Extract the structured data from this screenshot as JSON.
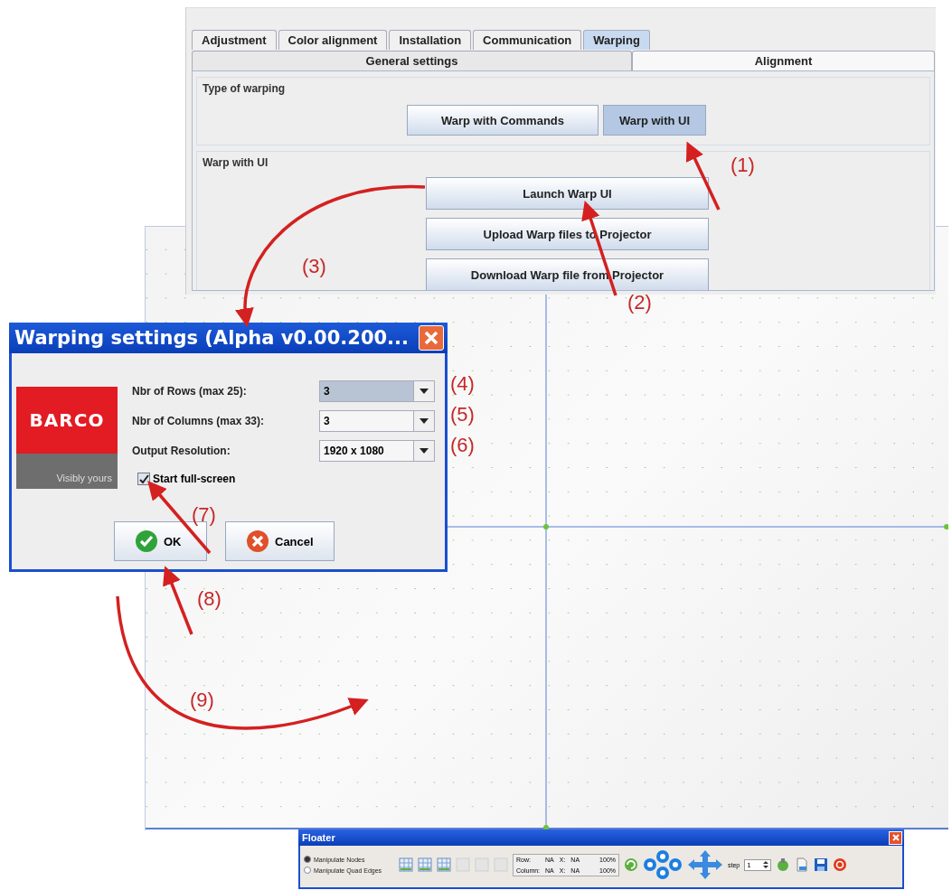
{
  "config_window": {
    "tabs": [
      {
        "label": "Adjustment",
        "selected": false
      },
      {
        "label": "Color alignment",
        "selected": false
      },
      {
        "label": "Installation",
        "selected": false
      },
      {
        "label": "Communication",
        "selected": false
      },
      {
        "label": "Warping",
        "selected": true
      }
    ],
    "subtabs": [
      {
        "label": "General settings",
        "selected": false
      },
      {
        "label": "Alignment",
        "selected": true
      }
    ],
    "type_of_warping": {
      "title": "Type of warping",
      "buttons": [
        {
          "label": "Warp with Commands",
          "selected": false
        },
        {
          "label": "Warp with UI",
          "selected": true
        }
      ]
    },
    "warp_with_ui": {
      "title": "Warp with UI",
      "buttons": [
        "Launch Warp UI",
        "Upload Warp files to Projector",
        "Download Warp file from Projector"
      ]
    }
  },
  "dialog": {
    "title": "Warping settings (Alpha v0.00.200...",
    "logo": {
      "brand": "BARCO",
      "tagline": "Visibly yours"
    },
    "fields": [
      {
        "label": "Nbr of Rows (max 25):",
        "value": "3",
        "focused": true
      },
      {
        "label": "Nbr of Columns (max 33):",
        "value": "3",
        "focused": false
      },
      {
        "label": "Output Resolution:",
        "value": "1920 x 1080",
        "focused": false
      }
    ],
    "checkbox": {
      "label": "Start full-screen",
      "checked": true
    },
    "buttons": [
      {
        "label": "OK",
        "kind": "ok"
      },
      {
        "label": "Cancel",
        "kind": "cancel"
      }
    ]
  },
  "floater": {
    "title": "Floater",
    "modes": [
      {
        "label": "Manipulate Nodes",
        "selected": true
      },
      {
        "label": "Manipulate Quad Edges",
        "selected": false
      }
    ],
    "readouts": [
      {
        "label": "Row:",
        "value": "NA",
        "x_label": "X:",
        "x_value": "NA",
        "percent": "100%"
      },
      {
        "label": "Column:",
        "value": "NA",
        "x_label": "X:",
        "x_value": "NA",
        "percent": "100%"
      }
    ],
    "step_label": "step",
    "step_value": "1"
  },
  "annotations": [
    "(1)",
    "(2)",
    "(3)",
    "(4)",
    "(5)",
    "(6)",
    "(7)",
    "(8)",
    "(9)"
  ]
}
